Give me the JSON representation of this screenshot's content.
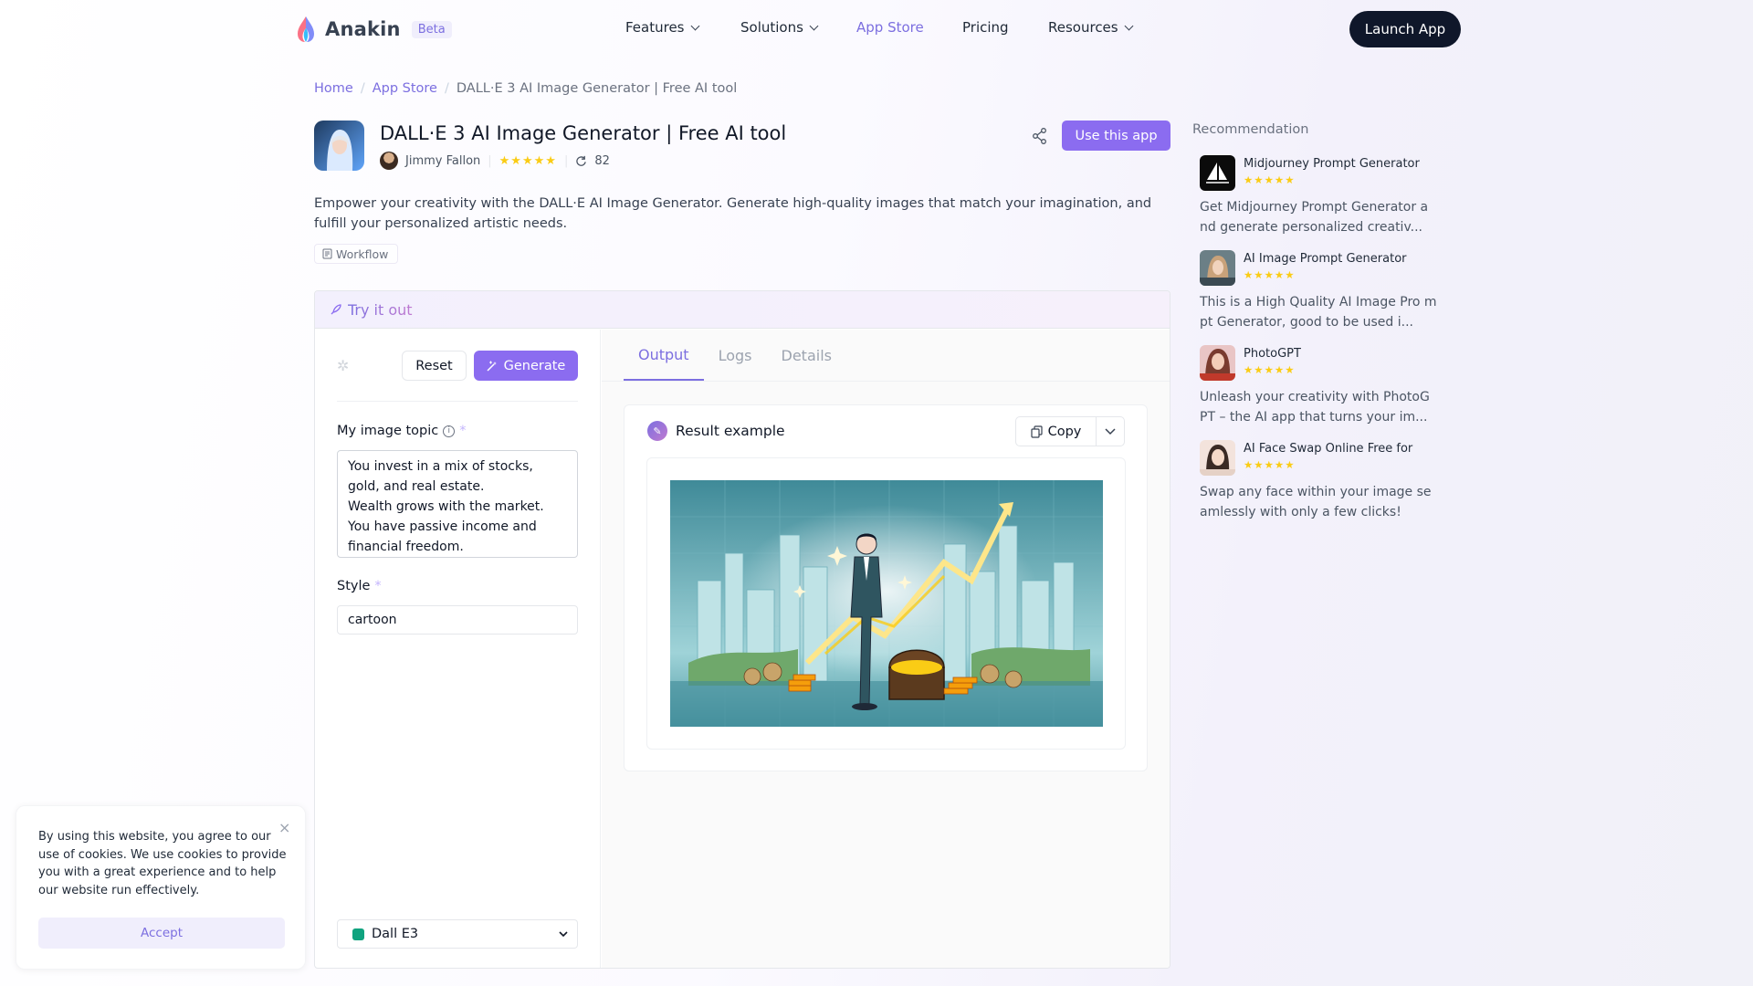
{
  "header": {
    "brand": "Anakin",
    "beta_label": "Beta",
    "nav": [
      {
        "label": "Features"
      },
      {
        "label": "Solutions"
      },
      {
        "label": "App Store"
      },
      {
        "label": "Pricing"
      },
      {
        "label": "Resources"
      }
    ],
    "launch_label": "Launch App"
  },
  "breadcrumb": {
    "home": "Home",
    "app_store": "App Store",
    "current": "DALL·E 3 AI Image Generator | Free AI tool"
  },
  "app": {
    "title": "DALL·E 3 AI Image Generator | Free AI tool",
    "author": "Jimmy Fallon",
    "stars": "★★★★★",
    "uses": "82",
    "use_label": "Use this app",
    "description": "Empower your creativity with the DALL·E AI Image Generator. Generate high-quality images that match your imagination, and fulfill your personalized artistic needs.",
    "tag": "Workflow"
  },
  "try_panel": {
    "title": "Try it out",
    "reset_label": "Reset",
    "generate_label": "Generate",
    "fields": {
      "topic_label": "My image topic",
      "topic_value": "You invest in a mix of stocks, gold, and real estate.\nWealth grows with the market. You have passive income and financial freedom.",
      "style_label": "Style",
      "style_value": "cartoon",
      "required_mark": "*"
    },
    "model": "Dall E3",
    "tabs": [
      {
        "label": "Output"
      },
      {
        "label": "Logs"
      },
      {
        "label": "Details"
      }
    ],
    "result_title": "Result example",
    "copy_label": "Copy"
  },
  "recommendation": {
    "title": "Recommendation",
    "items": [
      {
        "name": "Midjourney Prompt Generator",
        "stars": "★★★★★",
        "desc": "Get Midjourney Prompt Generator a nd generate personalized creativ..."
      },
      {
        "name": "AI Image Prompt Generator",
        "stars": "★★★★★",
        "desc": "This is a High Quality AI Image Pro mpt Generator, good to be used i..."
      },
      {
        "name": "PhotoGPT",
        "stars": "★★★★★",
        "desc": "Unleash your creativity with PhotoG PT – the AI app that turns your im..."
      },
      {
        "name": "AI Face Swap Online Free for",
        "stars": "★★★★★",
        "desc": "Swap any face within your image se amlessly with only a few clicks!"
      }
    ]
  },
  "cookie": {
    "text": "By using this website, you agree to our use of cookies. We use cookies to provide you with a great experience and to help our website run effectively.",
    "close": "×",
    "accept_label": "Accept"
  },
  "colors": {
    "accent": "#8b6cf0",
    "dark": "#0f172a",
    "star": "#facc15"
  }
}
